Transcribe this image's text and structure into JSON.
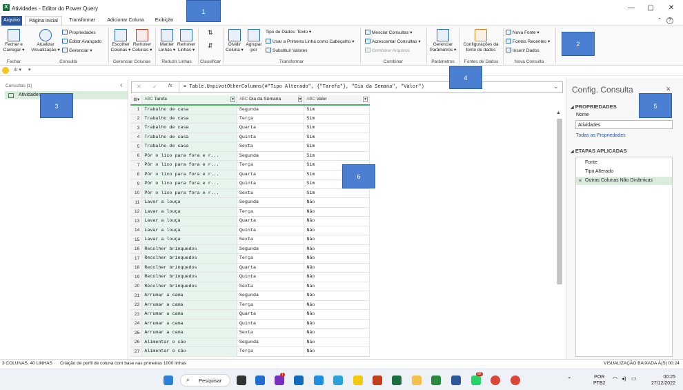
{
  "window": {
    "title": "Atividades - Editor do Power Query",
    "app_icon_label": "X",
    "minimize": "—",
    "restore": "▢",
    "close": "✕"
  },
  "ribbon_tabs": [
    "Arquivo",
    "Página Inicial",
    "Transformar",
    "Adicionar Coluna",
    "Exibição"
  ],
  "ribbon": {
    "fechar_carregar": "Fechar e\nCarregar ▾",
    "atualizar": "Atualizar\nVisualização ▾",
    "propriedades": "Propriedades",
    "editor_avancado": "Editor Avançado",
    "gerenciar": "Gerenciar ▾",
    "escolher_colunas": "Escolher\nColunas ▾",
    "remover_colunas": "Remover\nColunas ▾",
    "manter_linhas": "Manter\nLinhas ▾",
    "remover_linhas": "Remover\nLinhas ▾",
    "dividir_coluna": "Dividir\nColuna ▾",
    "agrupar_por": "Agrupar\npor",
    "tipo_de_dados": "Tipo de Dados: Texto ▾",
    "usar_primeira_linha": "Usar a Primeira Linha como Cabeçalho ▾",
    "substituir_valores": "Substituir Valores",
    "mesclar_consultas": "Mesclar Consultas ▾",
    "acrescentar_consultas": "Acrescentar Consultas ▾",
    "combinar_arquivos": "Combinar Arquivos",
    "gerenciar_parametros": "Gerenciar\nParâmetros ▾",
    "config_fonte": "Configurações da\nfonte de dados",
    "nova_fonte": "Nova Fonte ▾",
    "fontes_recentes": "Fontes Recentes ▾",
    "inserir_dados": "Inserir Dados",
    "groups": [
      "Fechar",
      "Consulta",
      "Gerenciar Colunas",
      "Reduzir Linhas",
      "Classificar",
      "Transformar",
      "Combinar",
      "Parâmetros",
      "Fontes de Dados",
      "Nova Consulta"
    ]
  },
  "queries_pane": {
    "header": "Consultas [1]",
    "collapse_icon": "‹",
    "items": [
      {
        "name": "Atividades"
      }
    ]
  },
  "formula_bar": {
    "cancel": "✕",
    "confirm": "✓",
    "fx": "fx",
    "formula": "= Table.UnpivotOtherColumns(#\"Tipo Alterado\", {\"Tarefa\"}, \"Dia da Semana\", \"Valor\")",
    "expand": "⌄"
  },
  "grid": {
    "columns": [
      {
        "name": "Tarefa",
        "type_icon": "ABC"
      },
      {
        "name": "Dia da Semana",
        "type_icon": "ABC"
      },
      {
        "name": "Valor",
        "type_icon": "ABC"
      }
    ],
    "rows": [
      [
        "1",
        "Trabalho de casa",
        "Segunda",
        "Sim"
      ],
      [
        "2",
        "Trabalho de casa",
        "Terça",
        "Sim"
      ],
      [
        "3",
        "Trabalho de casa",
        "Quarta",
        "Sim"
      ],
      [
        "4",
        "Trabalho de casa",
        "Quinta",
        "Sim"
      ],
      [
        "5",
        "Trabalho de casa",
        "Sexta",
        "Sim"
      ],
      [
        "6",
        "Pôr o lixo para fora e r...",
        "Segunda",
        "Sim"
      ],
      [
        "7",
        "Pôr o lixo para fora e r...",
        "Terça",
        "Sim"
      ],
      [
        "8",
        "Pôr o lixo para fora e r...",
        "Quarta",
        "Sim"
      ],
      [
        "9",
        "Pôr o lixo para fora e r...",
        "Quinta",
        "Sim"
      ],
      [
        "10",
        "Pôr o lixo para fora e r...",
        "Sexta",
        "Sim"
      ],
      [
        "11",
        "Lavar a louça",
        "Segunda",
        "Não"
      ],
      [
        "12",
        "Lavar a louça",
        "Terça",
        "Não"
      ],
      [
        "13",
        "Lavar a louça",
        "Quarta",
        "Não"
      ],
      [
        "14",
        "Lavar a louça",
        "Quinta",
        "Não"
      ],
      [
        "15",
        "Lavar a louça",
        "Sexta",
        "Não"
      ],
      [
        "16",
        "Recolher brinquedos",
        "Segunda",
        "Não"
      ],
      [
        "17",
        "Recolher brinquedos",
        "Terça",
        "Não"
      ],
      [
        "18",
        "Recolher brinquedos",
        "Quarta",
        "Não"
      ],
      [
        "19",
        "Recolher brinquedos",
        "Quinta",
        "Não"
      ],
      [
        "20",
        "Recolher brinquedos",
        "Sexta",
        "Não"
      ],
      [
        "21",
        "Arrumar a cama",
        "Segunda",
        "Não"
      ],
      [
        "22",
        "Arrumar a cama",
        "Terça",
        "Não"
      ],
      [
        "23",
        "Arrumar a cama",
        "Quarta",
        "Não"
      ],
      [
        "24",
        "Arrumar a cama",
        "Quinta",
        "Não"
      ],
      [
        "25",
        "Arrumar a cama",
        "Sexta",
        "Não"
      ],
      [
        "26",
        "Alimentar o cão",
        "Segunda",
        "Não"
      ],
      [
        "27",
        "Alimentar o cão",
        "Terça",
        "Não"
      ]
    ]
  },
  "settings": {
    "title": "Config. Consulta",
    "close": "✕",
    "propriedades_header": "PROPRIEDADES",
    "nome_label": "Nome",
    "nome_value": "Atividades",
    "todas_propriedades": "Todas as Propriedades",
    "etapas_header": "ETAPAS APLICADAS",
    "steps": [
      {
        "name": "Fonte"
      },
      {
        "name": "Tipo Alterado"
      },
      {
        "name": "Outras Colunas Não Dinâmicas",
        "delete": "✕"
      }
    ]
  },
  "status": {
    "left1": "3 COLUNAS, 40 LINHAS",
    "left2": "Criação de perfil de coluna com base nas primeiras 1000 linhas",
    "right": "VISUALIZAÇÃO BAIXADA À(S) 00:24"
  },
  "taskbar": {
    "search": "Pesquisar",
    "lang1": "POR",
    "lang2": "PTB2",
    "time": "00:25",
    "date": "27/12/2022",
    "badge_whatsapp": "68",
    "badge_teams": "1"
  },
  "callouts": [
    "1",
    "2",
    "3",
    "4",
    "5",
    "6"
  ]
}
